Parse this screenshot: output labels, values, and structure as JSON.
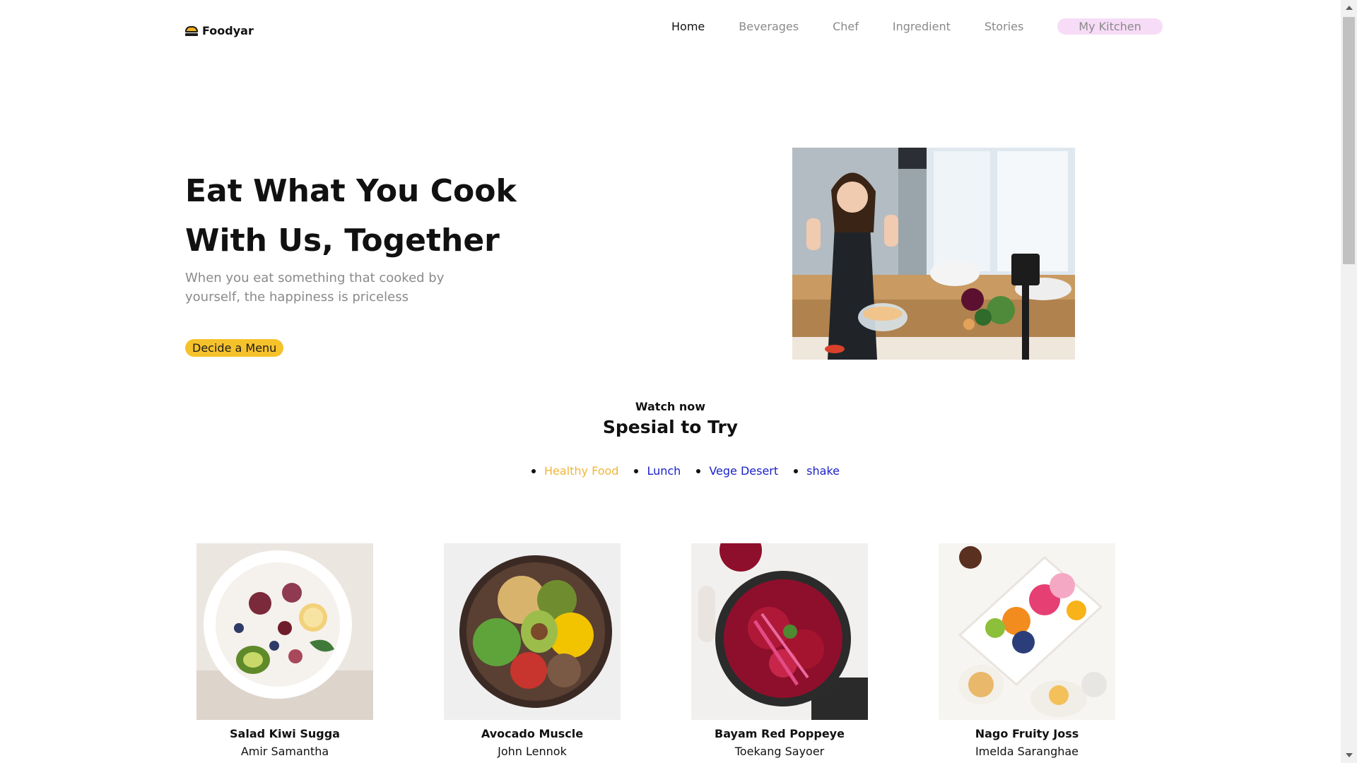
{
  "brand": {
    "name": "Foodyar",
    "icon": "burger-icon"
  },
  "nav": {
    "items": [
      {
        "label": "Home",
        "active": true
      },
      {
        "label": "Beverages",
        "active": false
      },
      {
        "label": "Chef",
        "active": false
      },
      {
        "label": "Ingredient",
        "active": false
      },
      {
        "label": "Stories",
        "active": false
      }
    ],
    "kitchen_label": "My Kitchen"
  },
  "hero": {
    "title_line1": "Eat What You Cook",
    "title_line2": "With Us, Together",
    "subtitle": "When you eat something that cooked by yourself, the happiness is priceless",
    "cta_label": "Decide a Menu"
  },
  "section": {
    "eyebrow": "Watch now",
    "title": "Spesial to Try",
    "tabs": [
      {
        "label": "Healthy Food",
        "active": true
      },
      {
        "label": "Lunch",
        "active": false
      },
      {
        "label": "Vege Desert",
        "active": false
      },
      {
        "label": "shake",
        "active": false
      }
    ]
  },
  "cards": [
    {
      "name": "Salad Kiwi Sugga",
      "author": "Amir Samantha"
    },
    {
      "name": "Avocado Muscle",
      "author": "John Lennok"
    },
    {
      "name": "Bayam Red Poppeye",
      "author": "Toekang Sayoer"
    },
    {
      "name": "Nago Fruity Joss",
      "author": "Imelda Saranghae"
    }
  ],
  "colors": {
    "accent_yellow": "#f6c22c",
    "tab_active": "#f0b53a",
    "tab_link": "#1a22c8",
    "kitchen_pill": "#f6dcf6"
  }
}
